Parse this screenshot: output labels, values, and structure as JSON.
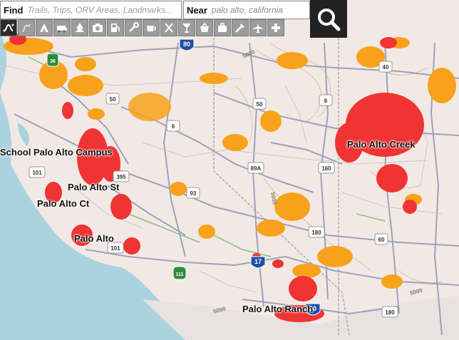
{
  "search": {
    "find_label": "Find",
    "find_placeholder": "Trails, Trips, ORV Areas, Landmarks...",
    "near_label": "Near",
    "near_value": "palo alto, california"
  },
  "category_icons": [
    "route-icon",
    "trail-icon",
    "camping-icon",
    "rv-icon",
    "forest-icon",
    "camera-icon",
    "fuel-icon",
    "tools-icon",
    "coffee-icon",
    "restaurant-icon",
    "bar-icon",
    "shopping-icon",
    "lodging-icon",
    "parts-icon",
    "airport-icon",
    "hospital-icon"
  ],
  "places": [
    {
      "name": "School Palo Alto Campus"
    },
    {
      "name": "Palo Alto St"
    },
    {
      "name": "Palo Alto Ct"
    },
    {
      "name": "Palo Alto"
    },
    {
      "name": "Palo Alto Creek"
    },
    {
      "name": "Palo Alto Ranch"
    }
  ],
  "shields": {
    "interstate": [
      "80",
      "17",
      "10"
    ],
    "us": [
      "50",
      "50",
      "6",
      "6",
      "101",
      "101",
      "395",
      "93",
      "160",
      "89A",
      "180",
      "60",
      "40",
      "180"
    ],
    "state": [
      "36",
      "111"
    ]
  },
  "contours": [
    "5000",
    "5000",
    "5000",
    "5000"
  ],
  "colors": {
    "red": "#f03333",
    "orange": "#f8a21c",
    "water": "#aad3df",
    "land": "#f2e9e4",
    "road": "#8a97b6"
  }
}
